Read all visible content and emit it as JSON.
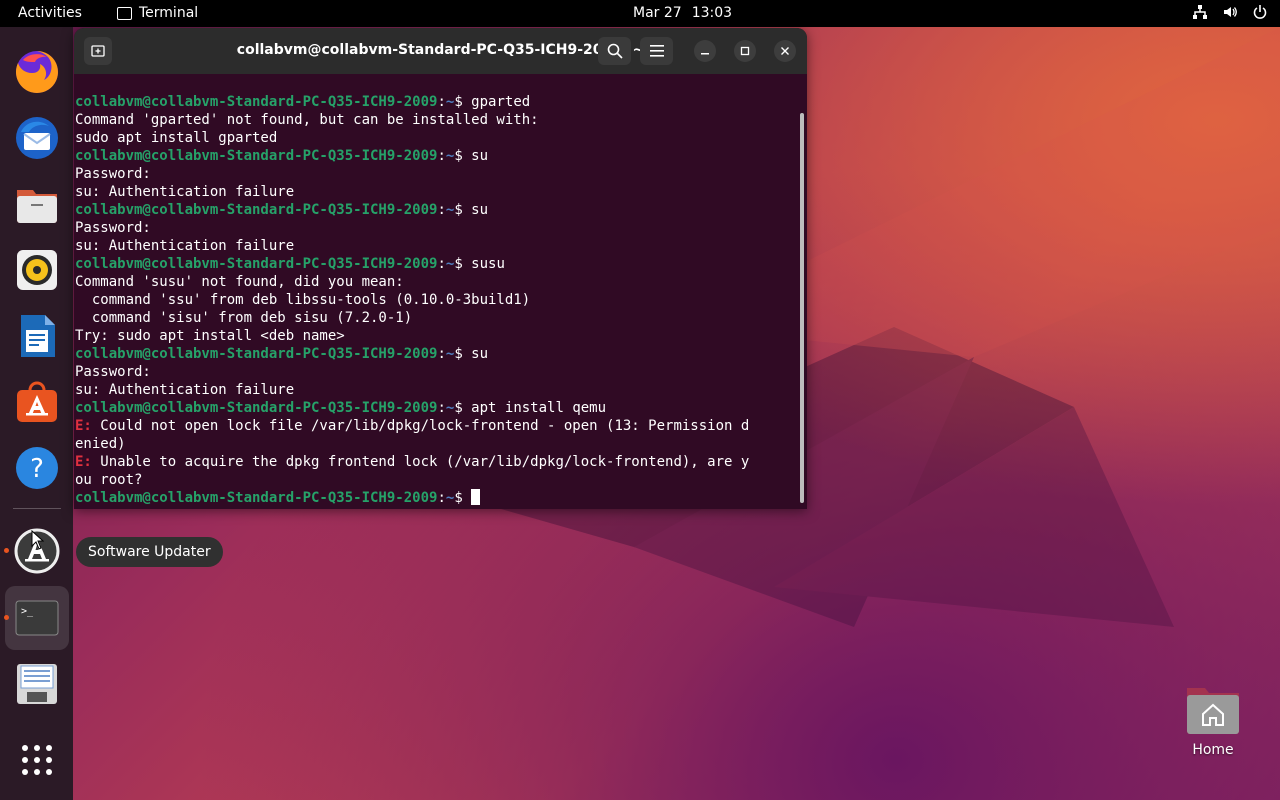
{
  "topbar": {
    "activities": "Activities",
    "app_name": "Terminal",
    "date": "Mar 27",
    "time": "13:03",
    "tray_icons": [
      "network-icon",
      "volume-icon",
      "power-icon"
    ]
  },
  "dock": {
    "items": [
      {
        "name": "firefox",
        "icon": "firefox-icon"
      },
      {
        "name": "thunderbird",
        "icon": "thunderbird-icon"
      },
      {
        "name": "files",
        "icon": "files-icon"
      },
      {
        "name": "rhythmbox",
        "icon": "rhythmbox-icon"
      },
      {
        "name": "libreoffice-writer",
        "icon": "writer-icon"
      },
      {
        "name": "ubuntu-software",
        "icon": "software-icon"
      },
      {
        "name": "help",
        "icon": "help-icon"
      },
      {
        "name": "software-updater",
        "icon": "updater-icon",
        "running": true
      },
      {
        "name": "terminal",
        "icon": "terminal-icon",
        "running": true,
        "active": true
      },
      {
        "name": "save-disk",
        "icon": "disk-icon"
      },
      {
        "name": "show-apps",
        "icon": "apps-grid-icon"
      }
    ],
    "tooltip": "Software Updater"
  },
  "terminal": {
    "title": "collabvm@collabvm-Standard-PC-Q35-ICH9-2009: ~",
    "prompt_user": "collabvm@collabvm-Standard-PC-Q35-ICH9-2009",
    "prompt_path": "~",
    "lines": [
      {
        "type": "cmd",
        "text": "gparted"
      },
      {
        "type": "out",
        "text": "Command 'gparted' not found, but can be installed with:"
      },
      {
        "type": "out",
        "text": "sudo apt install gparted"
      },
      {
        "type": "cmd",
        "text": "su"
      },
      {
        "type": "out",
        "text": "Password:"
      },
      {
        "type": "out",
        "text": "su: Authentication failure"
      },
      {
        "type": "cmd",
        "text": "su"
      },
      {
        "type": "out",
        "text": "Password:"
      },
      {
        "type": "out",
        "text": "su: Authentication failure"
      },
      {
        "type": "cmd",
        "text": "susu"
      },
      {
        "type": "out",
        "text": "Command 'susu' not found, did you mean:"
      },
      {
        "type": "out",
        "text": "  command 'ssu' from deb libssu-tools (0.10.0-3build1)"
      },
      {
        "type": "out",
        "text": "  command 'sisu' from deb sisu (7.2.0-1)"
      },
      {
        "type": "out",
        "text": "Try: sudo apt install <deb name>"
      },
      {
        "type": "cmd",
        "text": "su"
      },
      {
        "type": "out",
        "text": "Password:"
      },
      {
        "type": "out",
        "text": "su: Authentication failure"
      },
      {
        "type": "cmd",
        "text": "apt install qemu"
      },
      {
        "type": "err",
        "prefix": "E:",
        "text": " Could not open lock file /var/lib/dpkg/lock-frontend - open (13: Permission d"
      },
      {
        "type": "out",
        "text": "enied)"
      },
      {
        "type": "err",
        "prefix": "E:",
        "text": " Unable to acquire the dpkg frontend lock (/var/lib/dpkg/lock-frontend), are y"
      },
      {
        "type": "out",
        "text": "ou root?"
      },
      {
        "type": "prompt",
        "text": ""
      }
    ]
  },
  "desktop": {
    "home_label": "Home"
  },
  "colors": {
    "accent": "#e95420",
    "terminal_bg": "#300a24",
    "prompt_green": "#26a269",
    "error_red": "#e0313f"
  }
}
